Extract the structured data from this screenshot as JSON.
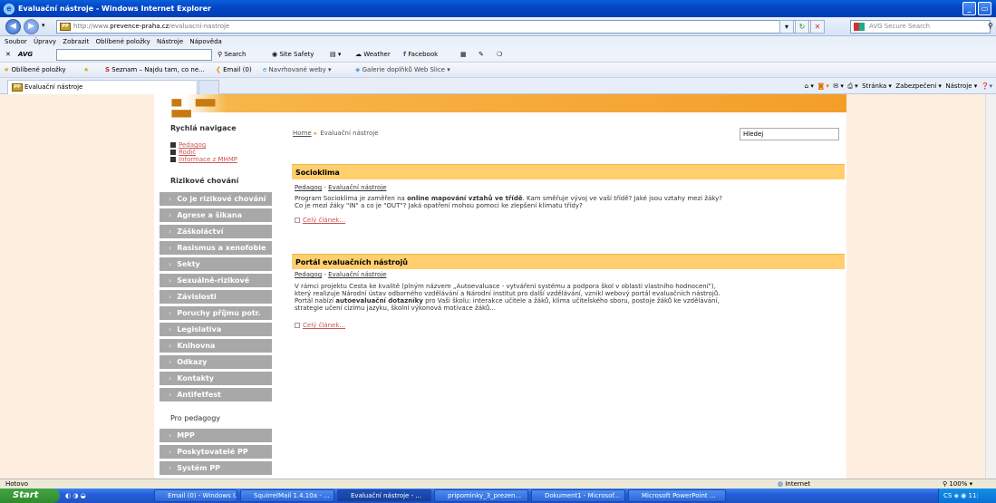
{
  "window": {
    "title": "Evaluační nástroje - Windows Internet Explorer"
  },
  "address": {
    "prefix": "http://www.",
    "domain": "prevence-praha.cz",
    "path": "/evaluacni-nastroje",
    "search_placeholder": "AVG Secure Search"
  },
  "menu": [
    "Soubor",
    "Úpravy",
    "Zobrazit",
    "Oblíbené položky",
    "Nástroje",
    "Nápověda"
  ],
  "avg_toolbar": {
    "brand": "AVG",
    "search": "Search",
    "site_safety": "Site Safety",
    "weather": "Weather",
    "facebook": "Facebook"
  },
  "favorites": {
    "label": "Oblíbené položky",
    "seznam": "Seznam – Najdu tam, co ne...",
    "email": "Email (0)",
    "suggested": "Navrhované weby",
    "gallery": "Galerie doplňků Web Slice"
  },
  "tab": {
    "title": "Evaluační nástroje"
  },
  "command_bar": {
    "page": "Stránka",
    "security": "Zabezpečení",
    "tools": "Nástroje"
  },
  "sidebar": {
    "quick_nav_title": "Rychlá navigace",
    "quick_links": [
      "Pedagog",
      "Rodič",
      "Informace z MHMP"
    ],
    "risk_title": "Rizikové chování",
    "risk_items": [
      "Co je rizikové chování",
      "Agrese a šikana",
      "Záškoláctví",
      "Rasismus a xenofobie",
      "Sekty",
      "Sexuálně-rizikové",
      "Závislosti",
      "Poruchy příjmu potr.",
      "Legislativa",
      "Knihovna",
      "Odkazy",
      "Kontakty",
      "Antifetfest"
    ],
    "teachers_title": "Pro pedagogy",
    "teachers_items": [
      "MPP",
      "Poskytovatelé PP",
      "Systém PP"
    ]
  },
  "breadcrumb": {
    "home": "Home",
    "current": "Evaluační nástroje"
  },
  "search_box": {
    "value": "Hledej"
  },
  "articles": [
    {
      "title": "Socioklima",
      "cat1": "Pedagog",
      "cat2": "Evaluační nástroje",
      "text_a": "Program Socioklima je zaměřen na ",
      "bold": "online mapování vztahů ve třídě",
      "text_b": ". Kam směřuje vývoj ve vaší třídě? Jaké jsou vztahy mezi žáky? Co je mezi žáky \"IN\" a co je \"OUT\"? Jaká opatření mohou pomoci ke zlepšení klimatu třídy?",
      "more": "Celý článek..."
    },
    {
      "title": "Portál evaluačních nástrojů",
      "cat1": "Pedagog",
      "cat2": "Evaluační nástroje",
      "text_a": "V rámci projektu Cesta ke kvalitě (plným názvem „Autoevaluace - vytváření systému a podpora škol v oblasti vlastního hodnocení\"), který realizuje Národní ústav odborného vzdělávání a Národní institut pro další vzdělávání, vznikl webový portál evaluačních nástrojů. Portál nabízí ",
      "bold": "autoevaluační dotazníky",
      "text_b": " pro Vaši školu: interakce učitele a žáků, klima učitelského sboru, postoje žáků ke vzdělávání, strategie učení cizímu jazyku, školní výkonová motivace žáků...",
      "more": "Celý článek..."
    }
  ],
  "status": {
    "left": "Hotovo",
    "zone": "Internet",
    "zoom": "100%"
  },
  "taskbar": {
    "start": "Start",
    "tasks": [
      "Email (0) - Windows I...",
      "SquirrelMail 1.4.10a - ...",
      "Evaluační nástroje - ...",
      "pripominky_3_prezen...",
      "Dokument1 - Microsof...",
      "Microsoft PowerPoint ..."
    ],
    "tray_lang": "CS",
    "clock": "11:"
  },
  "colors": {
    "accent": "#f49e2a",
    "article_header": "#ffcf6e",
    "menu_gray": "#a8a8a8",
    "side_bg": "#fdeee0"
  }
}
